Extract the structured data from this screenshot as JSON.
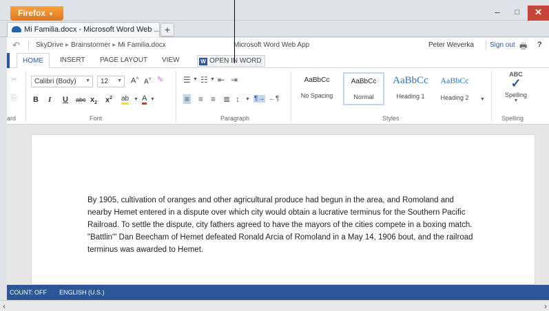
{
  "browser": {
    "menu_label": "Firefox",
    "tab_title": "Mi Familia.docx - Microsoft Word Web ...",
    "new_tab": "+",
    "window": {
      "minimize": "–",
      "maximize": "□",
      "close": "✕"
    }
  },
  "app_header": {
    "breadcrumb": [
      "SkyDrive",
      "Brainstormer",
      "Mi Familia.docx"
    ],
    "app_name": "Microsoft Word Web App",
    "user_name": "Peter Weverka",
    "sign_out": "Sign out",
    "help": "?"
  },
  "ribbon_tabs": {
    "home": "HOME",
    "insert": "INSERT",
    "page_layout": "PAGE LAYOUT",
    "view": "VIEW",
    "open_in_word": "OPEN IN WORD"
  },
  "ribbon": {
    "clipboard_label": "ard",
    "font_name": "Calibri (Body)",
    "font_size": "12",
    "font_label": "Font",
    "paragraph_label": "Paragraph",
    "styles_label": "Styles",
    "styles": [
      {
        "sample": "AaBbCc",
        "name": "No Spacing"
      },
      {
        "sample": "AaBbCc",
        "name": "Normal"
      },
      {
        "sample": "AaBbCc",
        "name": "Heading 1"
      },
      {
        "sample": "AaBbCc",
        "name": "Heading 2"
      }
    ],
    "spelling_abc": "ABC",
    "spelling_button": "Spelling",
    "spelling_label": "Spelling",
    "font_buttons": {
      "bold": "B",
      "italic": "I",
      "underline": "U",
      "strike": "abc",
      "subscript": "x",
      "superscript": "x",
      "highlight": "ab",
      "fontcolor": "A"
    }
  },
  "document": {
    "paragraph": "By 1905, cultivation of oranges and other agricultural produce had begun in the area, and Romoland and nearby Hemet entered in a dispute over which city would obtain a lucrative terminus for the Southern Pacific Railroad. To settle the dispute, city fathers agreed to have the mayors of the cities compete in a boxing match. \"Battlin'\" Dan Beecham of Hemet defeated Ronald Arcia of Romoland in a May 14, 1906 bout, and the railroad terminus was awarded to Hemet."
  },
  "status_bar": {
    "count": "COUNT: OFF",
    "language": "ENGLISH (U.S.)"
  },
  "colors": {
    "accent": "#2b579a",
    "firefox_orange": "#e8831f",
    "close_red": "#c7443a"
  }
}
